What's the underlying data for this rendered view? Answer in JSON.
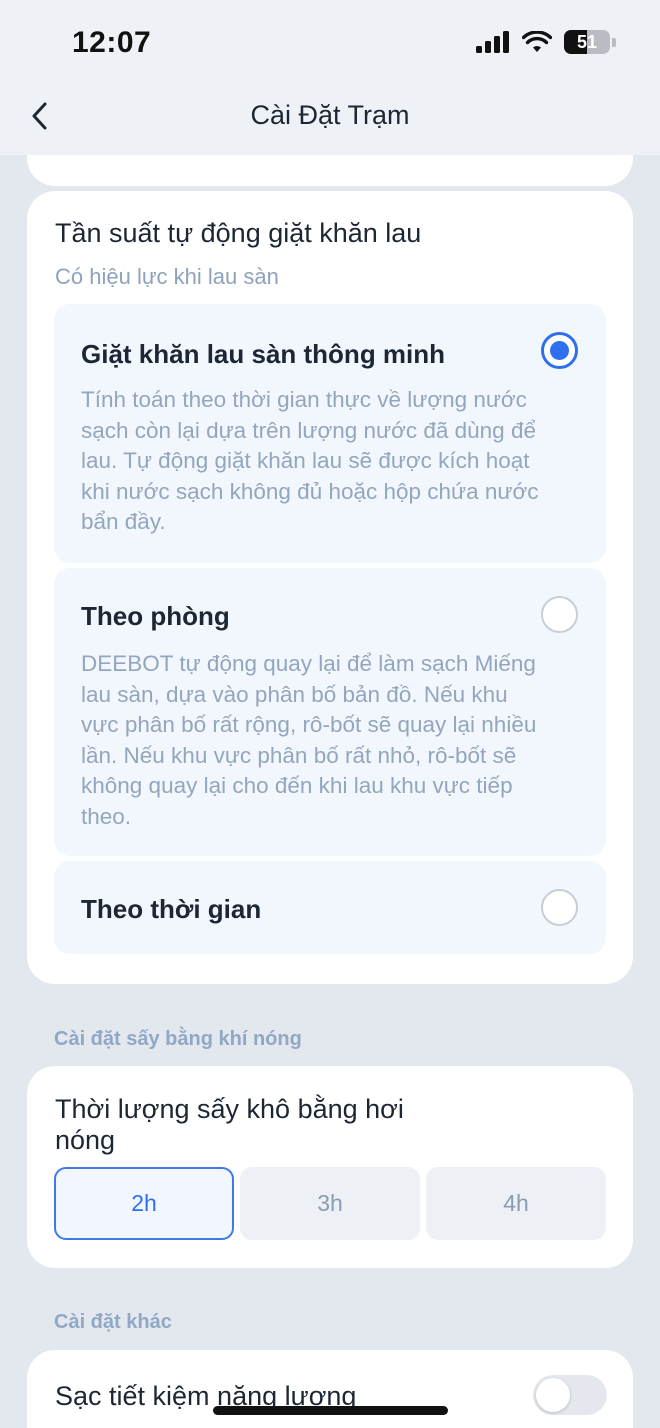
{
  "status_bar": {
    "time": "12:07",
    "battery": "51"
  },
  "nav": {
    "title": "Cài Đặt Trạm"
  },
  "wash_frequency": {
    "title": "Tần suất tự động giặt khăn lau",
    "subtitle": "Có hiệu lực khi lau sàn",
    "options": [
      {
        "title": "Giặt khăn lau sàn thông minh",
        "lines": [
          "Tính toán theo thời gian thực về lượng nước",
          "sạch còn lại dựa trên lượng nước đã dùng để",
          "lau. Tự động giặt khăn lau sẽ được kích hoạt",
          "khi nước sạch không đủ hoặc hộp chứa nước",
          "bẩn đầy."
        ],
        "selected": true
      },
      {
        "title": "Theo phòng",
        "lines": [
          "DEEBOT tự động quay lại để làm sạch Miếng",
          "lau sàn, dựa vào phân bố bản đồ. Nếu khu",
          "vực phân bố rất rộng, rô-bốt sẽ quay lại nhiều",
          "lần. Nếu khu vực phân bố rất nhỏ, rô-bốt sẽ",
          "không quay lại cho đến khi lau khu vực tiếp",
          "theo."
        ],
        "selected": false
      },
      {
        "title": "Theo thời gian",
        "selected": false
      }
    ]
  },
  "hot_air_drying": {
    "section_label": "Cài đặt sấy bằng khí nóng",
    "title_line1": "Thời lượng sấy khô bằng hơi",
    "title_line2": "nóng",
    "durations": [
      "2h",
      "3h",
      "4h"
    ],
    "selected_duration": "2h"
  },
  "other": {
    "section_label": "Cài đặt khác",
    "energy_saving_label": "Sạc tiết kiệm năng lượng",
    "energy_saving_on": false
  },
  "colors": {
    "accent": "#2e6ff0",
    "background": "#e3e8ef",
    "muted_text": "#93a6bd"
  }
}
